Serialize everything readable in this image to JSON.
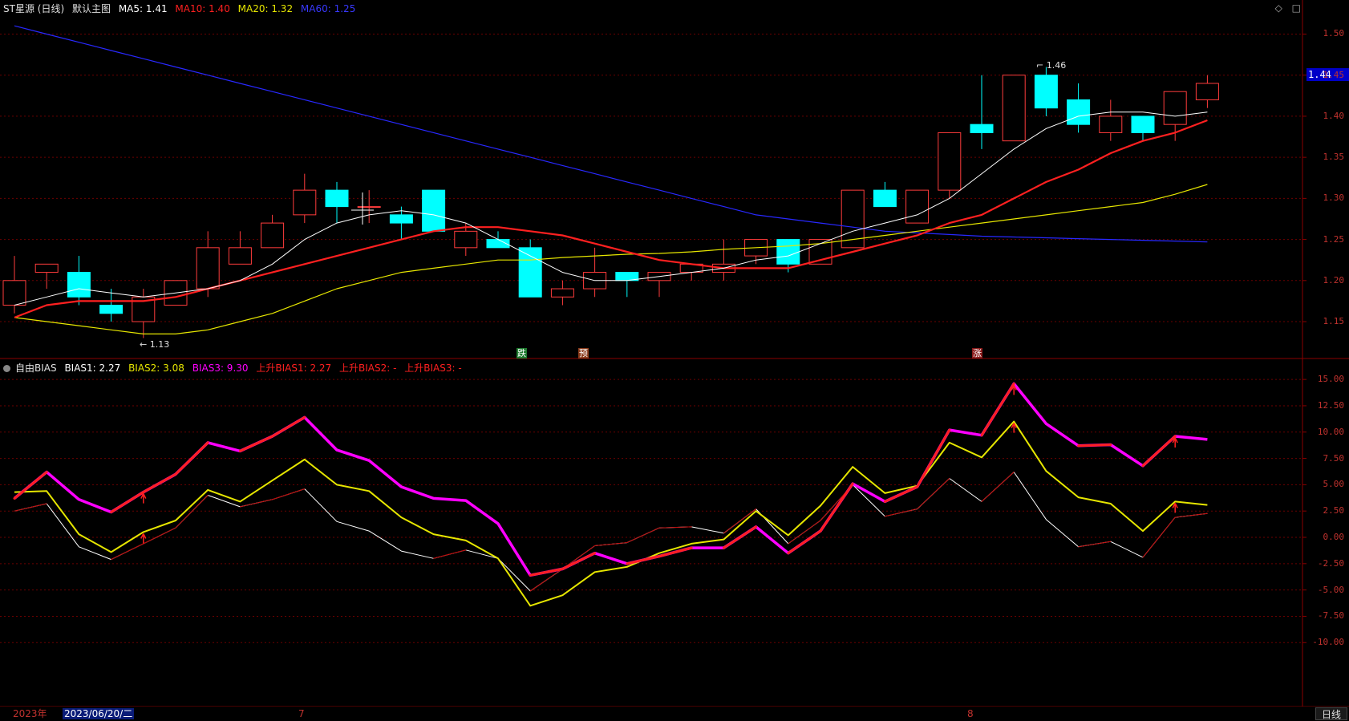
{
  "main_legend": {
    "title": "ST星源 (日线)",
    "subtitle": "默认主图",
    "ma5": "MA5: 1.41",
    "ma10": "MA10: 1.40",
    "ma20": "MA20: 1.32",
    "ma60": "MA60: 1.25"
  },
  "indicator_legend": {
    "name": "自由BIAS",
    "bias1": "BIAS1: 2.27",
    "bias2": "BIAS2: 3.08",
    "bias3": "BIAS3: 9.30",
    "up_bias1": "上升BIAS1: 2.27",
    "up_bias2": "上升BIAS2: -",
    "up_bias3": "上升BIAS3: -"
  },
  "price_axis": [
    "1.50",
    "1.45",
    "1.40",
    "1.35",
    "1.30",
    "1.25",
    "1.20",
    "1.15"
  ],
  "bias_axis": [
    "15.00",
    "12.50",
    "10.00",
    "7.50",
    "5.00",
    "2.50",
    "0.00",
    "-2.50",
    "-5.00",
    "-7.50",
    "-10.00"
  ],
  "current_price": "1.44",
  "high_marker": "1.46",
  "low_marker": "1.13",
  "signals": [
    {
      "text": "跌",
      "color": "#1e7a2e"
    },
    {
      "text": "预",
      "color": "#8a3a1a"
    },
    {
      "text": "涨",
      "color": "#8a1a1a"
    }
  ],
  "bottom": {
    "year": "2023年",
    "selected_date": "2023/06/20/二",
    "month7": "7",
    "month8": "8",
    "period": "日线"
  },
  "top_icons": {
    "diamond": "◇",
    "square": "□"
  },
  "colors": {
    "up": "#ff3c3c",
    "down": "#00ffff",
    "ma5": "#ffffff",
    "ma10": "#ff2020",
    "ma20": "#e6e600",
    "ma60": "#2828ff",
    "bias3": "#ff00ff",
    "bias2": "#e6e600",
    "bias1": "#ffffff",
    "grid": "#6b0000"
  },
  "chart_data": {
    "type": "candlestick",
    "candles": [
      {
        "o": 1.17,
        "c": 1.2,
        "h": 1.23,
        "l": 1.16
      },
      {
        "o": 1.21,
        "c": 1.22,
        "h": 1.22,
        "l": 1.19
      },
      {
        "o": 1.21,
        "c": 1.18,
        "h": 1.23,
        "l": 1.17
      },
      {
        "o": 1.17,
        "c": 1.16,
        "h": 1.19,
        "l": 1.15
      },
      {
        "o": 1.15,
        "c": 1.18,
        "h": 1.19,
        "l": 1.13
      },
      {
        "o": 1.17,
        "c": 1.2,
        "h": 1.2,
        "l": 1.17
      },
      {
        "o": 1.19,
        "c": 1.24,
        "h": 1.26,
        "l": 1.18
      },
      {
        "o": 1.22,
        "c": 1.24,
        "h": 1.26,
        "l": 1.22
      },
      {
        "o": 1.24,
        "c": 1.27,
        "h": 1.28,
        "l": 1.24
      },
      {
        "o": 1.28,
        "c": 1.31,
        "h": 1.33,
        "l": 1.27
      },
      {
        "o": 1.31,
        "c": 1.29,
        "h": 1.32,
        "l": 1.27
      },
      {
        "o": 1.29,
        "c": 1.29,
        "h": 1.31,
        "l": 1.27
      },
      {
        "o": 1.28,
        "c": 1.27,
        "h": 1.29,
        "l": 1.25
      },
      {
        "o": 1.31,
        "c": 1.26,
        "h": 1.31,
        "l": 1.26
      },
      {
        "o": 1.24,
        "c": 1.26,
        "h": 1.27,
        "l": 1.23
      },
      {
        "o": 1.25,
        "c": 1.24,
        "h": 1.26,
        "l": 1.24
      },
      {
        "o": 1.24,
        "c": 1.18,
        "h": 1.25,
        "l": 1.18
      },
      {
        "o": 1.18,
        "c": 1.19,
        "h": 1.2,
        "l": 1.17
      },
      {
        "o": 1.19,
        "c": 1.21,
        "h": 1.24,
        "l": 1.18
      },
      {
        "o": 1.21,
        "c": 1.2,
        "h": 1.21,
        "l": 1.18
      },
      {
        "o": 1.2,
        "c": 1.21,
        "h": 1.21,
        "l": 1.18
      },
      {
        "o": 1.21,
        "c": 1.22,
        "h": 1.22,
        "l": 1.2
      },
      {
        "o": 1.21,
        "c": 1.22,
        "h": 1.25,
        "l": 1.2
      },
      {
        "o": 1.23,
        "c": 1.25,
        "h": 1.25,
        "l": 1.22
      },
      {
        "o": 1.25,
        "c": 1.22,
        "h": 1.25,
        "l": 1.21
      },
      {
        "o": 1.22,
        "c": 1.25,
        "h": 1.25,
        "l": 1.22
      },
      {
        "o": 1.24,
        "c": 1.31,
        "h": 1.31,
        "l": 1.24
      },
      {
        "o": 1.31,
        "c": 1.29,
        "h": 1.32,
        "l": 1.29
      },
      {
        "o": 1.27,
        "c": 1.31,
        "h": 1.31,
        "l": 1.27
      },
      {
        "o": 1.31,
        "c": 1.38,
        "h": 1.38,
        "l": 1.3
      },
      {
        "o": 1.39,
        "c": 1.38,
        "h": 1.45,
        "l": 1.36
      },
      {
        "o": 1.37,
        "c": 1.45,
        "h": 1.45,
        "l": 1.37
      },
      {
        "o": 1.45,
        "c": 1.41,
        "h": 1.46,
        "l": 1.4
      },
      {
        "o": 1.42,
        "c": 1.39,
        "h": 1.44,
        "l": 1.38
      },
      {
        "o": 1.38,
        "c": 1.4,
        "h": 1.42,
        "l": 1.37
      },
      {
        "o": 1.4,
        "c": 1.38,
        "h": 1.4,
        "l": 1.37
      },
      {
        "o": 1.39,
        "c": 1.43,
        "h": 1.43,
        "l": 1.37
      },
      {
        "o": 1.42,
        "c": 1.44,
        "h": 1.45,
        "l": 1.41
      }
    ],
    "ma5": [
      1.17,
      1.18,
      1.19,
      1.185,
      1.18,
      1.185,
      1.19,
      1.2,
      1.22,
      1.25,
      1.27,
      1.28,
      1.285,
      1.28,
      1.27,
      1.25,
      1.23,
      1.21,
      1.2,
      1.2,
      1.205,
      1.21,
      1.215,
      1.225,
      1.23,
      1.245,
      1.26,
      1.27,
      1.28,
      1.3,
      1.33,
      1.36,
      1.385,
      1.4,
      1.405,
      1.405,
      1.4,
      1.405
    ],
    "ma10": [
      1.155,
      1.17,
      1.175,
      1.175,
      1.175,
      1.18,
      1.19,
      1.2,
      1.21,
      1.22,
      1.23,
      1.24,
      1.25,
      1.26,
      1.265,
      1.265,
      1.26,
      1.255,
      1.245,
      1.235,
      1.225,
      1.22,
      1.215,
      1.215,
      1.215,
      1.225,
      1.235,
      1.245,
      1.255,
      1.27,
      1.28,
      1.3,
      1.32,
      1.335,
      1.355,
      1.37,
      1.38,
      1.395
    ],
    "ma20": [
      1.155,
      1.15,
      1.145,
      1.14,
      1.135,
      1.135,
      1.14,
      1.15,
      1.16,
      1.175,
      1.19,
      1.2,
      1.21,
      1.215,
      1.22,
      1.225,
      1.225,
      1.228,
      1.23,
      1.232,
      1.233,
      1.235,
      1.238,
      1.24,
      1.242,
      1.245,
      1.25,
      1.255,
      1.26,
      1.265,
      1.27,
      1.275,
      1.28,
      1.285,
      1.29,
      1.295,
      1.305,
      1.317
    ],
    "ma60": [
      1.51,
      1.5,
      1.49,
      1.48,
      1.47,
      1.46,
      1.45,
      1.44,
      1.43,
      1.42,
      1.41,
      1.4,
      1.39,
      1.38,
      1.37,
      1.36,
      1.35,
      1.34,
      1.33,
      1.32,
      1.31,
      1.3,
      1.29,
      1.28,
      1.275,
      1.27,
      1.265,
      1.26,
      1.258,
      1.256,
      1.254,
      1.253,
      1.252,
      1.251,
      1.25,
      1.249,
      1.248,
      1.247
    ],
    "bias3": [
      3.7,
      6.2,
      3.6,
      2.4,
      4.3,
      6.0,
      9.0,
      8.2,
      9.6,
      11.4,
      8.3,
      7.3,
      4.8,
      3.7,
      3.5,
      1.3,
      -3.6,
      -3.0,
      -1.5,
      -2.5,
      -1.8,
      -1.0,
      -1.0,
      1.0,
      -1.5,
      0.6,
      5.1,
      3.4,
      4.8,
      10.2,
      9.7,
      14.6,
      10.8,
      8.7,
      8.8,
      6.8,
      9.6,
      9.3
    ],
    "bias2": [
      4.3,
      4.4,
      0.3,
      -1.4,
      0.5,
      1.6,
      4.5,
      3.4,
      5.4,
      7.4,
      5.0,
      4.4,
      1.9,
      0.3,
      -0.3,
      -2.0,
      -6.5,
      -5.5,
      -3.3,
      -2.8,
      -1.5,
      -0.6,
      -0.2,
      2.5,
      0.2,
      3.0,
      6.7,
      4.2,
      4.9,
      9.0,
      7.6,
      11.0,
      6.3,
      3.8,
      3.2,
      0.6,
      3.4,
      3.08
    ],
    "bias1": [
      2.5,
      3.2,
      -0.9,
      -2.1,
      -0.6,
      0.9,
      4.0,
      2.9,
      3.6,
      4.6,
      1.5,
      0.6,
      -1.3,
      -2.0,
      -1.2,
      -2.0,
      -5.1,
      -3.0,
      -0.8,
      -0.5,
      0.9,
      1.0,
      0.4,
      2.7,
      -0.6,
      1.6,
      5.0,
      2.0,
      2.7,
      5.6,
      3.4,
      6.2,
      1.7,
      -0.9,
      -0.4,
      -1.9,
      1.9,
      2.27
    ],
    "bias_ylim": [
      -16,
      16
    ],
    "price_ylim": [
      1.11,
      1.52
    ]
  }
}
